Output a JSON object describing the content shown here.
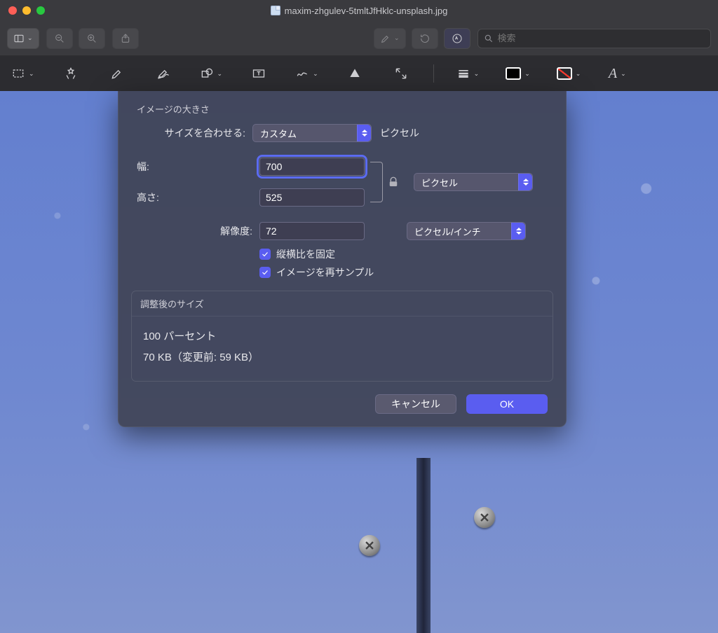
{
  "window": {
    "filename": "maxim-zhgulev-5tmltJfHklc-unsplash.jpg"
  },
  "search": {
    "placeholder": "検索"
  },
  "dialog": {
    "section1_title": "イメージの大きさ",
    "fit_label": "サイズを合わせる:",
    "fit_value": "カスタム",
    "fit_unit": "ピクセル",
    "width_label": "幅:",
    "width_value": "700",
    "height_label": "高さ:",
    "height_value": "525",
    "unit_value": "ピクセル",
    "resolution_label": "解像度:",
    "resolution_value": "72",
    "resolution_unit": "ピクセル/インチ",
    "aspect_label": "縦横比を固定",
    "resample_label": "イメージを再サンプル",
    "section2_title": "調整後のサイズ",
    "percent_line": "100 パーセント",
    "size_line": "70 KB（変更前: 59 KB）",
    "cancel": "キャンセル",
    "ok": "OK"
  }
}
